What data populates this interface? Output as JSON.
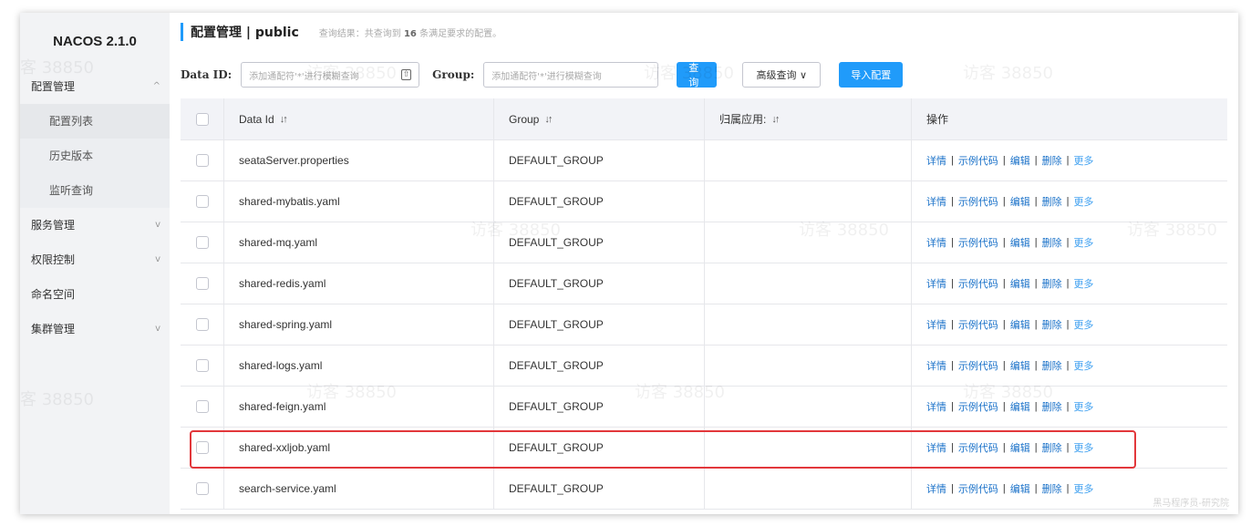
{
  "sidebar": {
    "brand": "NACOS 2.1.0",
    "config_group": "配置管理",
    "config_items": [
      "配置列表",
      "历史版本",
      "监听查询"
    ],
    "service_group": "服务管理",
    "auth_group": "权限控制",
    "namespace": "命名空间",
    "cluster_group": "集群管理",
    "chevron_up": "^",
    "chevron_down": "v"
  },
  "header": {
    "title": "配置管理 | public",
    "summary_prefix": "查询结果：共查询到",
    "summary_count": "16",
    "summary_suffix": "条满足要求的配置。"
  },
  "filter": {
    "data_id_label": "Data ID:",
    "data_id_placeholder": "添加通配符'*'进行模糊查询",
    "group_label": "Group:",
    "group_placeholder": "添加通配符'*'进行模糊查询",
    "search_button": "查询",
    "advanced_button": "高级查询 ∨",
    "import_button": "导入配置"
  },
  "table": {
    "columns": [
      "Data Id",
      "Group",
      "归属应用:",
      "操作"
    ],
    "sort_icon": "↓↑",
    "rows": [
      {
        "data_id": "seataServer.properties",
        "group": "DEFAULT_GROUP",
        "app": ""
      },
      {
        "data_id": "shared-mybatis.yaml",
        "group": "DEFAULT_GROUP",
        "app": ""
      },
      {
        "data_id": "shared-mq.yaml",
        "group": "DEFAULT_GROUP",
        "app": ""
      },
      {
        "data_id": "shared-redis.yaml",
        "group": "DEFAULT_GROUP",
        "app": ""
      },
      {
        "data_id": "shared-spring.yaml",
        "group": "DEFAULT_GROUP",
        "app": ""
      },
      {
        "data_id": "shared-logs.yaml",
        "group": "DEFAULT_GROUP",
        "app": ""
      },
      {
        "data_id": "shared-feign.yaml",
        "group": "DEFAULT_GROUP",
        "app": ""
      },
      {
        "data_id": "shared-xxljob.yaml",
        "group": "DEFAULT_GROUP",
        "app": ""
      },
      {
        "data_id": "search-service.yaml",
        "group": "DEFAULT_GROUP",
        "app": ""
      }
    ],
    "ops": {
      "detail": "详情",
      "sample": "示例代码",
      "edit": "编辑",
      "delete": "删除",
      "more": "更多",
      "sep": "|"
    }
  },
  "watermark": {
    "visitor": "访客 38850",
    "footer": "黑马程序员-研究院"
  },
  "colors": {
    "primary": "#209bfa",
    "link": "#1b72c9",
    "highlight": "#e2373b"
  }
}
